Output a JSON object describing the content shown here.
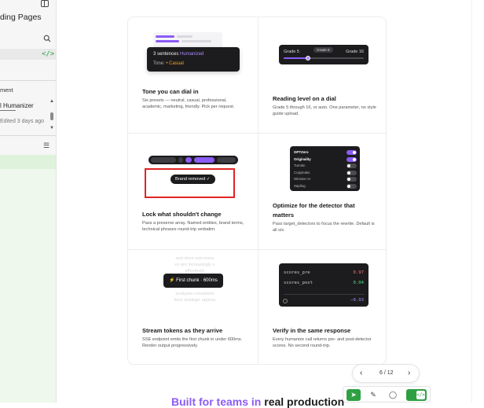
{
  "sidebar": {
    "title": "ding Pages",
    "section_label": "ment",
    "item_name": "l Humanizer",
    "item_time": "Edited 3 days ago",
    "code_glyph": "</>"
  },
  "cards": [
    {
      "title": "Tone you can dial in",
      "desc": "Six presets — neutral, casual, professional, academic, marketing, friendly. Pick per request.",
      "preview": {
        "line1_prefix": "3 sentences",
        "line1_highlight": "Humanized",
        "line2_prefix": "Tone:",
        "line2_value": "• Casual"
      }
    },
    {
      "title": "Reading level on a dial",
      "desc": "Grade 5 through 16, or auto. One parameter, no style guide upload.",
      "preview": {
        "left_label": "Grade 5",
        "right_label": "Grade 16",
        "pill": "Grade 8",
        "level_fraction": 0.3
      }
    },
    {
      "title": "Lock what shouldn't change",
      "desc": "Pass a preserve array. Named entities, brand terms, technical phrases round-trip verbatim.",
      "preview": {
        "badge": "Brand removed ✓"
      }
    },
    {
      "title": "Optimize for the detector that matters",
      "title_line1": "Optimize for the detector that",
      "title_line2": "matters",
      "desc": "Pass target_detectors to focus the rewrite. Default is all six.",
      "preview": {
        "detectors": [
          {
            "name": "GPTZero",
            "on": true
          },
          {
            "name": "Originality",
            "on": true
          },
          {
            "name": "Turnitin",
            "on": false
          },
          {
            "name": "Copyleaks",
            "on": false
          },
          {
            "name": "Winston AI",
            "on": false
          },
          {
            "name": "Sapling",
            "on": false
          }
        ]
      }
    },
    {
      "title": "Stream tokens as they arrive",
      "desc": "SSE endpoint emits the first chunk in under 600ms. Render output progressively.",
      "preview": {
        "ghost_lines": [
          "and drive outcomes",
          "es are increasingly s",
          "effectively"
        ],
        "ghost_lines_bottom": [
          "analyses considerin",
          "their strategic approa"
        ],
        "pill": "First chunk · 600ms"
      }
    },
    {
      "title": "Verify in the same response",
      "desc": "Every humanize call returns pre- and post-detector scores. No second round-trip.",
      "preview": {
        "rows": [
          {
            "key": "scores_pre",
            "value": "0.97",
            "color": "#f87171"
          },
          {
            "key": "scores_post",
            "value": "0.04",
            "color": "#4ade80"
          }
        ],
        "delta": "−0.93",
        "delta_color": "#a78bfa"
      }
    }
  ],
  "pager": {
    "prev": "‹",
    "text": "6 / 12",
    "next": "›"
  },
  "headline": {
    "accent": "Built for teams in",
    "rest": " real production"
  },
  "toolbar": {
    "pointer": "➤",
    "pen": "✎",
    "comment": "◯",
    "code": "</>"
  },
  "colors": {
    "accent": "#8b5cf6",
    "highlight_box": "#e02424",
    "toolbar_green": "#2ea043"
  }
}
